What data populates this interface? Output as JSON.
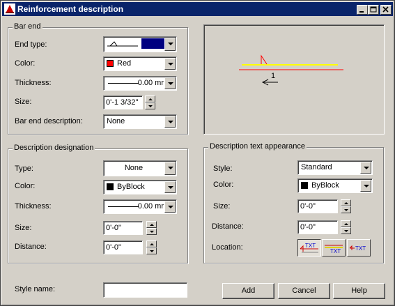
{
  "window": {
    "title": "Reinforcement description",
    "controls": [
      "minimize-icon",
      "maximize-icon",
      "close-icon"
    ]
  },
  "bar_end": {
    "group_title": "Bar end",
    "end_type_label": "End type:",
    "end_type_color": "#000080",
    "color_label": "Color:",
    "color_value": "Red",
    "color_swatch": "#ff0000",
    "thickness_label": "Thickness:",
    "thickness_value": "0.00 mr",
    "size_label": "Size:",
    "size_value": "0'-1 3/32\"",
    "description_label": "Bar end description:",
    "description_value": "None"
  },
  "description_designation": {
    "group_title": "Description designation",
    "type_label": "Type:",
    "type_value": "None",
    "color_label": "Color:",
    "color_value": "ByBlock",
    "color_swatch": "#000000",
    "thickness_label": "Thickness:",
    "thickness_value": "0.00 mr",
    "size_label": "Size:",
    "size_value": "0'-0\"",
    "distance_label": "Distance:",
    "distance_value": "0'-0\""
  },
  "text_appearance": {
    "group_title": "Description text appearance",
    "style_label": "Style:",
    "style_value": "Standard",
    "color_label": "Color:",
    "color_value": "ByBlock",
    "color_swatch": "#000000",
    "size_label": "Size:",
    "size_value": "0'-0\"",
    "distance_label": "Distance:",
    "distance_value": "0'-0\"",
    "location_label": "Location:",
    "location_options": [
      "TXT",
      "TXT",
      "TXT"
    ],
    "location_selected": 0
  },
  "preview": {
    "marker_label": "1",
    "bar_color": "#ffff00",
    "line_color": "#ff0000"
  },
  "footer": {
    "style_name_label": "Style name:",
    "style_name_value": "",
    "add_label": "Add",
    "cancel_label": "Cancel",
    "help_label": "Help"
  }
}
